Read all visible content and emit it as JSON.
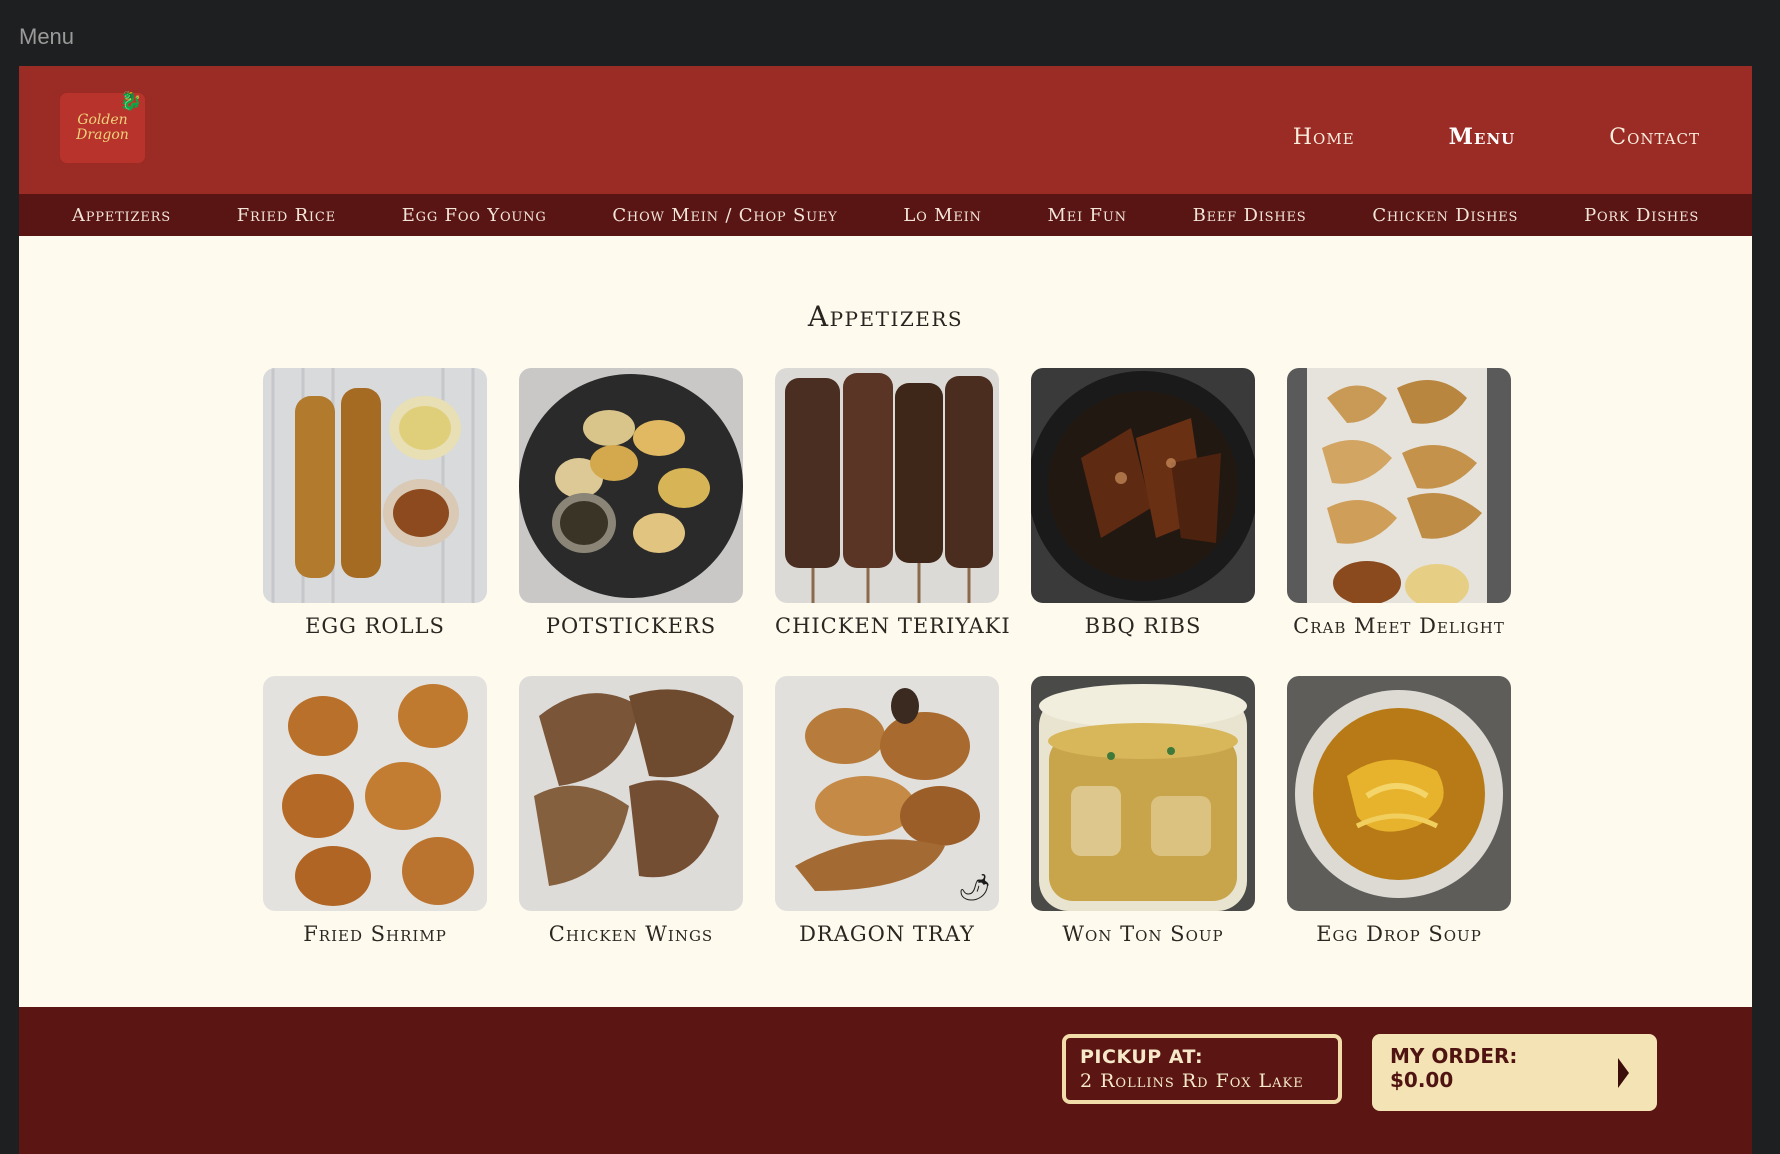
{
  "window": {
    "title": "Menu"
  },
  "brand": {
    "logo_line1": "Golden",
    "logo_line2": "Dragon"
  },
  "main_nav": [
    {
      "label": "Home",
      "active": false
    },
    {
      "label": "Menu",
      "active": true
    },
    {
      "label": "Contact",
      "active": false
    }
  ],
  "categories": [
    "Appetizers",
    "Fried Rice",
    "Egg Foo Young",
    "Chow Mein / Chop Suey",
    "Lo Mein",
    "Mei Fun",
    "Beef Dishes",
    "Chicken Dishes",
    "Pork Dishes"
  ],
  "section": {
    "title": "Appetizers"
  },
  "items": [
    {
      "name": "EGG ROLLS",
      "icon": "egg-roll-photo"
    },
    {
      "name": "POTSTICKERS",
      "icon": "potstickers-photo"
    },
    {
      "name": "CHICKEN TERIYAKI",
      "icon": "chicken-teriyaki-photo"
    },
    {
      "name": "BBQ RIBS",
      "icon": "bbq-ribs-photo"
    },
    {
      "name": "Crab Meet Delight",
      "icon": "crab-rangoon-photo"
    },
    {
      "name": "Fried Shrimp",
      "icon": "fried-shrimp-photo"
    },
    {
      "name": "Chicken Wings",
      "icon": "chicken-wings-photo"
    },
    {
      "name": "DRAGON TRAY",
      "icon": "dragon-tray-photo",
      "spicy": true
    },
    {
      "name": "Won Ton Soup",
      "icon": "won-ton-soup-photo"
    },
    {
      "name": "Egg Drop Soup",
      "icon": "egg-drop-soup-photo"
    }
  ],
  "footer": {
    "pickup_label": "PICKUP AT:",
    "pickup_address": "2 Rollins Rd Fox Lake",
    "order_label": "MY ORDER:",
    "order_total": "$0.00"
  },
  "colors": {
    "header": "#9a2b25",
    "category_bar": "#591414",
    "page_bg": "#fefbee",
    "footer": "#5b1513",
    "order_box": "#f3e3b5"
  }
}
